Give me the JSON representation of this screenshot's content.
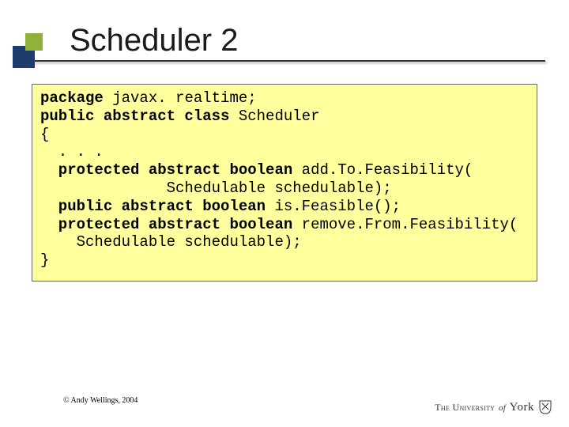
{
  "title": "Scheduler 2",
  "code": {
    "line1_kw": "package",
    "line1_rest": " javax. realtime;",
    "line2_kw": "public abstract class",
    "line2_rest": " Scheduler",
    "brace_open": "{",
    "dots": "  . . .",
    "line3_kw": "  protected abstract boolean",
    "line3_rest": " add.To.Feasibility(",
    "line4": "              Schedulable schedulable);",
    "line5_kw": "  public abstract boolean",
    "line5_rest": " is.Feasible();",
    "line6_kw": "  protected abstract boolean",
    "line6_rest": " remove.From.Feasibility(",
    "line7": "    Schedulable schedulable);",
    "brace_close": "}"
  },
  "copyright": "© Andy Wellings, 2004",
  "logo": {
    "the": "The",
    "uni": " University",
    "of": "of",
    "york": "York"
  }
}
